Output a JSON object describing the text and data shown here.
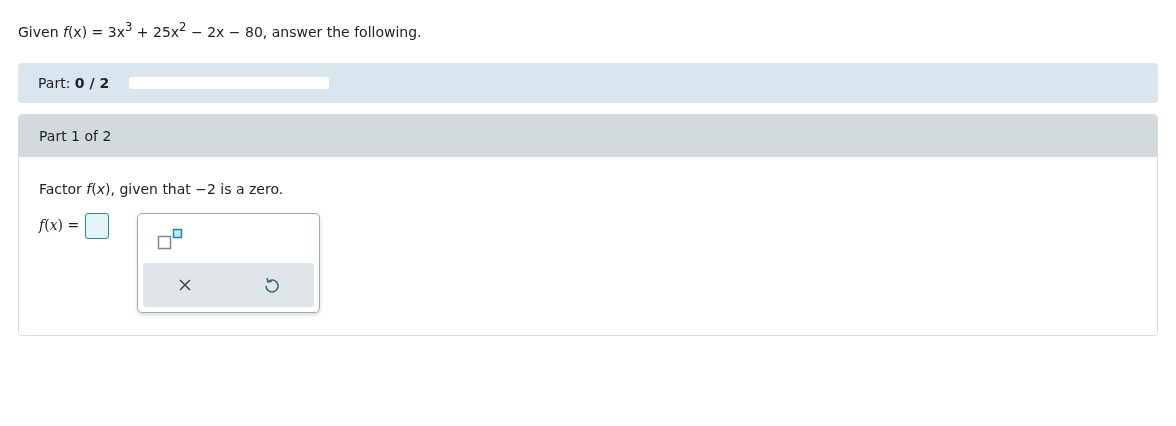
{
  "question": "Given *f*(x) = 3x$^{3}$ + 25x$^{2}$ − 2x − 80, answer the following.",
  "progress": {
    "label": "Part: **0 / 2**",
    "level": 0
  },
  "part": {
    "title": "Part 1 of 2",
    "prompt": "Factor *f*(*x*), given that −2 is a zero.",
    "answer_label": "*f*(*x*) ="
  }
}
